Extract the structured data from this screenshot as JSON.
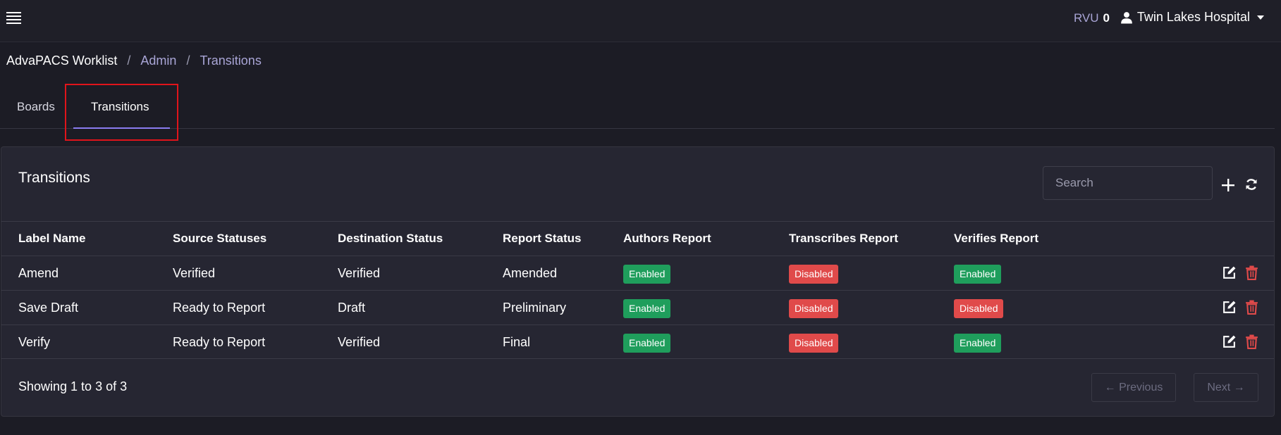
{
  "topbar": {
    "rvu_label": "RVU",
    "rvu_value": "0",
    "user_name": "Twin Lakes Hospital"
  },
  "breadcrumb": {
    "home": "AdvaPACS Worklist",
    "sep1": "/",
    "admin": "Admin",
    "sep2": "/",
    "current": "Transitions"
  },
  "tabs": [
    {
      "label": "Boards",
      "active": false
    },
    {
      "label": "Transitions",
      "active": true
    }
  ],
  "card": {
    "title": "Transitions",
    "search_placeholder": "Search"
  },
  "table": {
    "headers": [
      "Label Name",
      "Source Statuses",
      "Destination Status",
      "Report Status",
      "Authors Report",
      "Transcribes Report",
      "Verifies Report"
    ],
    "rows": [
      {
        "label": "Amend",
        "source": "Verified",
        "destination": "Verified",
        "report_status": "Amended",
        "authors": "Enabled",
        "transcribes": "Disabled",
        "verifies": "Enabled"
      },
      {
        "label": "Save Draft",
        "source": "Ready to Report",
        "destination": "Draft",
        "report_status": "Preliminary",
        "authors": "Enabled",
        "transcribes": "Disabled",
        "verifies": "Disabled"
      },
      {
        "label": "Verify",
        "source": "Ready to Report",
        "destination": "Verified",
        "report_status": "Final",
        "authors": "Enabled",
        "transcribes": "Disabled",
        "verifies": "Enabled"
      }
    ]
  },
  "footer": {
    "showing": "Showing 1 to 3 of 3",
    "previous": "← Previous",
    "next": "Next →"
  },
  "colors": {
    "enabled": "#1f9e5c",
    "disabled": "#e04a4a",
    "accent": "#8a7cf0",
    "highlight": "#e0141b"
  },
  "icons": [
    "menu-icon",
    "user-icon",
    "caret-down-icon",
    "plus-icon",
    "refresh-icon",
    "edit-icon",
    "trash-icon"
  ]
}
